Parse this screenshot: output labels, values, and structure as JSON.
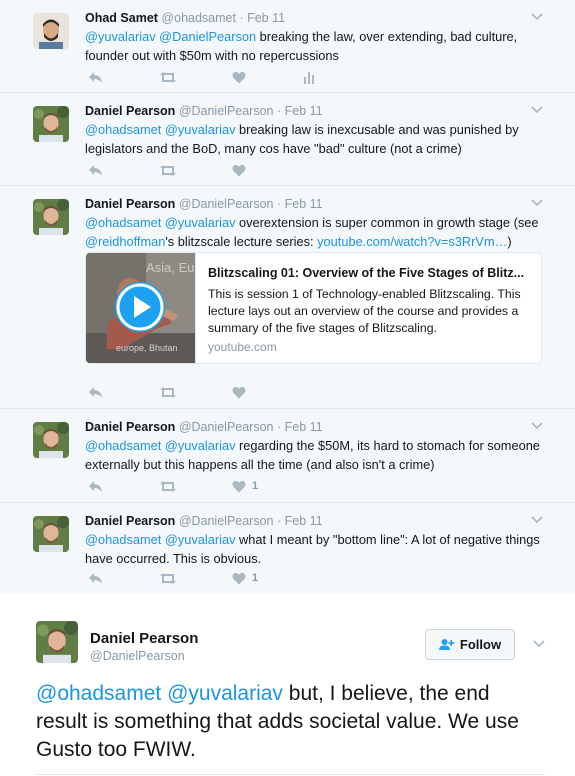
{
  "tweets": [
    {
      "name": "Ohad Samet",
      "handle": "@ohadsamet",
      "date": "· Feb 11",
      "segments": [
        {
          "text": "@yuvalariav",
          "link": true
        },
        {
          "text": " ",
          "link": false
        },
        {
          "text": "@DanielPearson",
          "link": true
        },
        {
          "text": " breaking the law,  over extending, bad culture, founder out with $50m with no repercussions",
          "link": false
        }
      ],
      "likes": "",
      "show_analytics": true
    },
    {
      "name": "Daniel Pearson",
      "handle": "@DanielPearson",
      "date": "· Feb 11",
      "segments": [
        {
          "text": "@ohadsamet",
          "link": true
        },
        {
          "text": " ",
          "link": false
        },
        {
          "text": "@yuvalariav",
          "link": true
        },
        {
          "text": " breaking law is inexcusable and was punished by legislators and the BoD, many cos have \"bad\" culture (not a crime)",
          "link": false
        }
      ],
      "likes": "",
      "show_analytics": false
    },
    {
      "name": "Daniel Pearson",
      "handle": "@DanielPearson",
      "date": "· Feb 11",
      "segments": [
        {
          "text": "@ohadsamet",
          "link": true
        },
        {
          "text": " ",
          "link": false
        },
        {
          "text": "@yuvalariav",
          "link": true
        },
        {
          "text": " overextension is super common in growth stage (see ",
          "link": false
        },
        {
          "text": "@reidhoffman",
          "link": true
        },
        {
          "text": "'s blitzscale lecture series: ",
          "link": false
        },
        {
          "text": "youtube.com/watch?v=s3RrVm…",
          "link": true
        },
        {
          "text": ")",
          "link": false
        }
      ],
      "card": {
        "title": "Blitzscaling 01: Overview of the Five Stages of Blitz...",
        "description": "This is session 1 of Technology-enabled Blitzscaling. This lecture lays out an overview of the course and provides a summary of the five stages of Blitzscaling.",
        "domain": "youtube.com",
        "thumb_text_1": "Asia, Eu",
        "thumb_text_2": "europe, Bhutan"
      },
      "likes": "",
      "show_analytics": false
    },
    {
      "name": "Daniel Pearson",
      "handle": "@DanielPearson",
      "date": "· Feb 11",
      "segments": [
        {
          "text": "@ohadsamet",
          "link": true
        },
        {
          "text": " ",
          "link": false
        },
        {
          "text": "@yuvalariav",
          "link": true
        },
        {
          "text": " regarding the $50M, its hard to stomach for someone externally but this happens all the time (and also isn't a crime)",
          "link": false
        }
      ],
      "likes": "1",
      "show_analytics": false
    },
    {
      "name": "Daniel Pearson",
      "handle": "@DanielPearson",
      "date": "· Feb 11",
      "segments": [
        {
          "text": "@ohadsamet",
          "link": true
        },
        {
          "text": " ",
          "link": false
        },
        {
          "text": "@yuvalariav",
          "link": true
        },
        {
          "text": " what I meant by \"bottom line\": A lot of negative things have occurred. This is obvious.",
          "link": false
        }
      ],
      "likes": "1",
      "show_analytics": false
    }
  ],
  "main_tweet": {
    "name": "Daniel Pearson",
    "handle": "@DanielPearson",
    "follow_label": "Follow",
    "segments": [
      {
        "text": "@ohadsamet",
        "link": true
      },
      {
        "text": " ",
        "link": false
      },
      {
        "text": "@yuvalariav",
        "link": true
      },
      {
        "text": " but, I believe, the end result is something that adds societal value. We use Gusto too FWIW.",
        "link": false
      }
    ]
  },
  "colors": {
    "link": "#1b95e0",
    "icon": "#aab8c2",
    "muted": "#8899a6"
  },
  "icons": {
    "reply": "reply-icon",
    "retweet": "retweet-icon",
    "like": "heart-icon",
    "analytics": "analytics-icon",
    "caret": "chevron-down-icon",
    "follow": "add-user-icon",
    "play": "play-icon"
  }
}
